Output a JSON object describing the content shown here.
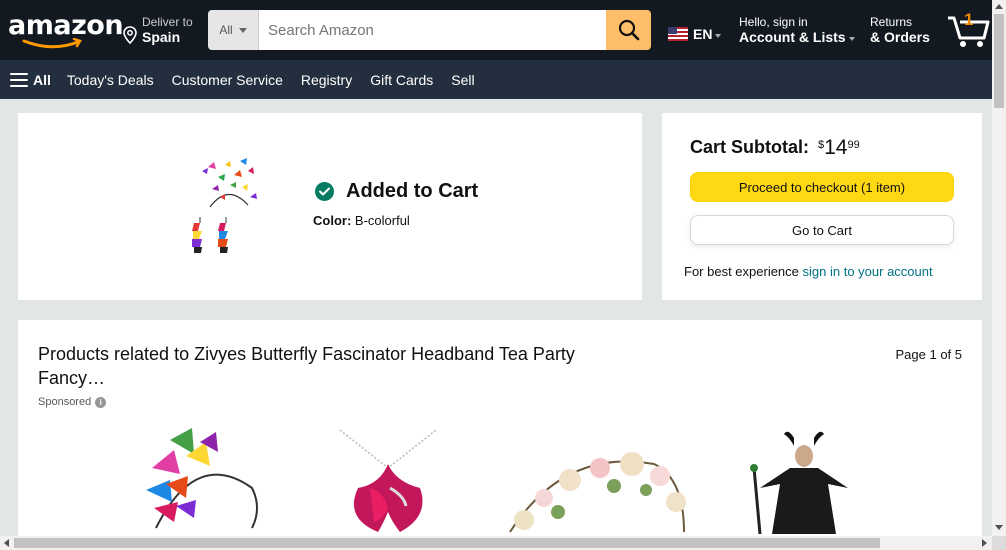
{
  "header": {
    "logo_text": "amazon",
    "deliver_line1": "Deliver to",
    "deliver_line2": "Spain",
    "search_category": "All",
    "search_placeholder": "Search Amazon",
    "language": "EN",
    "account_line1": "Hello, sign in",
    "account_line2": "Account & Lists",
    "orders_line1": "Returns",
    "orders_line2": "& Orders",
    "cart_count": "1",
    "colors": {
      "nav_bg": "#131921",
      "subnav_bg": "#232f3e",
      "search_button": "#febd69",
      "cart_count": "#f08804"
    }
  },
  "subnav": {
    "all_label": "All",
    "links": [
      "Today's Deals",
      "Customer Service",
      "Registry",
      "Gift Cards",
      "Sell"
    ]
  },
  "added": {
    "title": "Added to Cart",
    "color_label": "Color:",
    "color_value": "B-colorful",
    "icon": "check-circle-icon"
  },
  "subtotal": {
    "label": "Cart Subtotal:",
    "currency": "$",
    "whole": "14",
    "fraction": "99",
    "checkout_label": "Proceed to checkout (1 item)",
    "go_to_cart_label": "Go to Cart",
    "best_exp_text": "For best experience",
    "best_exp_link": "sign in to your account",
    "colors": {
      "checkout_button": "#ffd814",
      "link": "#007185"
    }
  },
  "related": {
    "title": "Products related to Zivyes Butterfly Fascinator Headband Tea Party Fancy…",
    "sponsored": "Sponsored",
    "page_indicator": "Page 1 of 5",
    "items": [
      "butterfly-headband-image",
      "butterfly-necklace-image",
      "flower-crown-image",
      "maleficent-costume-image"
    ]
  }
}
